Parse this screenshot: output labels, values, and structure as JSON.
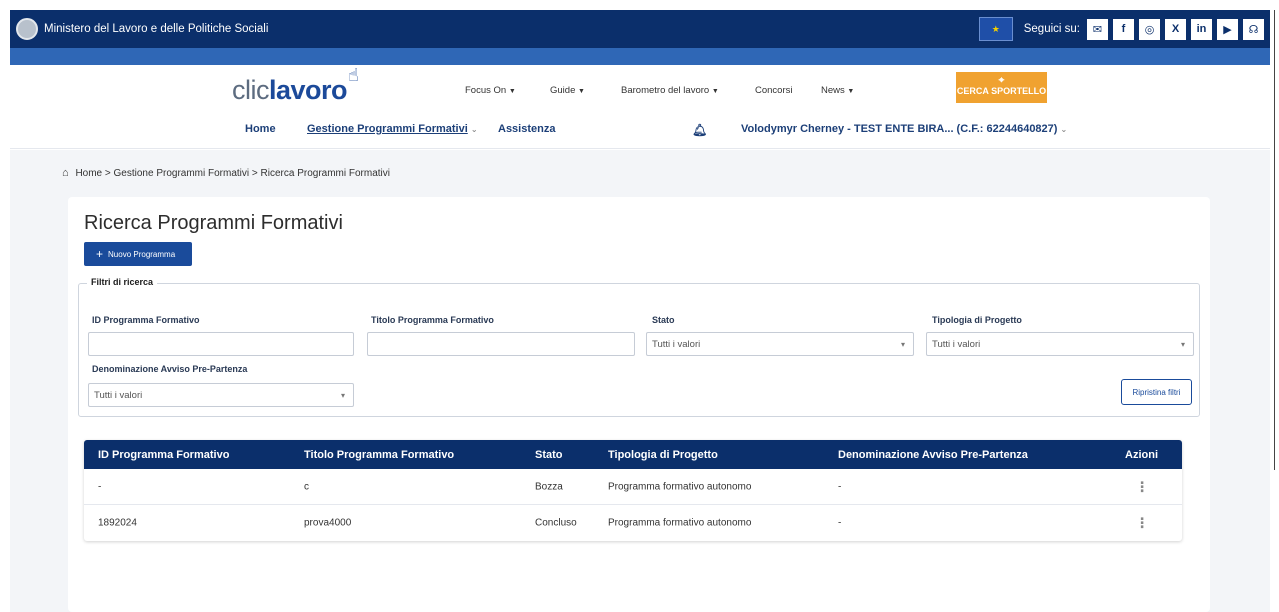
{
  "gov_bar": {
    "title": "Ministero del Lavoro e delle Politiche Sociali",
    "follow_label": "Seguici su:",
    "social_icons": [
      "✉",
      "f",
      "◎",
      "X",
      "in",
      "▶",
      "☊"
    ]
  },
  "header": {
    "logo_clic": "clic",
    "logo_lavoro": "lavoro",
    "top_nav": {
      "focus_on": "Focus On",
      "guide": "Guide",
      "barometro": "Barometro del lavoro",
      "concorsi": "Concorsi",
      "news": "News"
    },
    "cerca_sportello": "CERCA SPORTELLO",
    "main_nav": {
      "home": "Home",
      "gestione": "Gestione Programmi Formativi",
      "assistenza": "Assistenza",
      "user": "Volodymyr Cherney - TEST ENTE BIRA... (C.F.: 62244640827)"
    }
  },
  "breadcrumb": {
    "items": [
      "Home",
      "Gestione Programmi Formativi",
      "Ricerca Programmi Formativi"
    ],
    "separator": ">"
  },
  "page": {
    "title": "Ricerca Programmi Formativi",
    "new_button": "Nuovo Programma"
  },
  "filters": {
    "legend": "Filtri di ricerca",
    "id_label": "ID Programma Formativo",
    "id_value": "",
    "titolo_label": "Titolo Programma Formativo",
    "titolo_value": "",
    "stato_label": "Stato",
    "stato_value": "Tutti i valori",
    "tipologia_label": "Tipologia di Progetto",
    "tipologia_value": "Tutti i valori",
    "avviso_label": "Denominazione Avviso Pre-Partenza",
    "avviso_value": "Tutti i valori",
    "reset_button": "Ripristina filtri"
  },
  "table": {
    "headers": {
      "id": "ID Programma Formativo",
      "titolo": "Titolo Programma Formativo",
      "stato": "Stato",
      "tipologia": "Tipologia di Progetto",
      "avviso": "Denominazione Avviso Pre-Partenza",
      "azioni": "Azioni"
    },
    "rows": [
      {
        "id": "-",
        "titolo": "c",
        "stato": "Bozza",
        "tipologia": "Programma formativo autonomo",
        "avviso": "-"
      },
      {
        "id": "1892024",
        "titolo": "prova4000",
        "stato": "Concluso",
        "tipologia": "Programma formativo autonomo",
        "avviso": "-"
      }
    ]
  },
  "colors": {
    "navy": "#0b2f6b",
    "primary": "#1a4b9b",
    "orange": "#f0a230"
  }
}
